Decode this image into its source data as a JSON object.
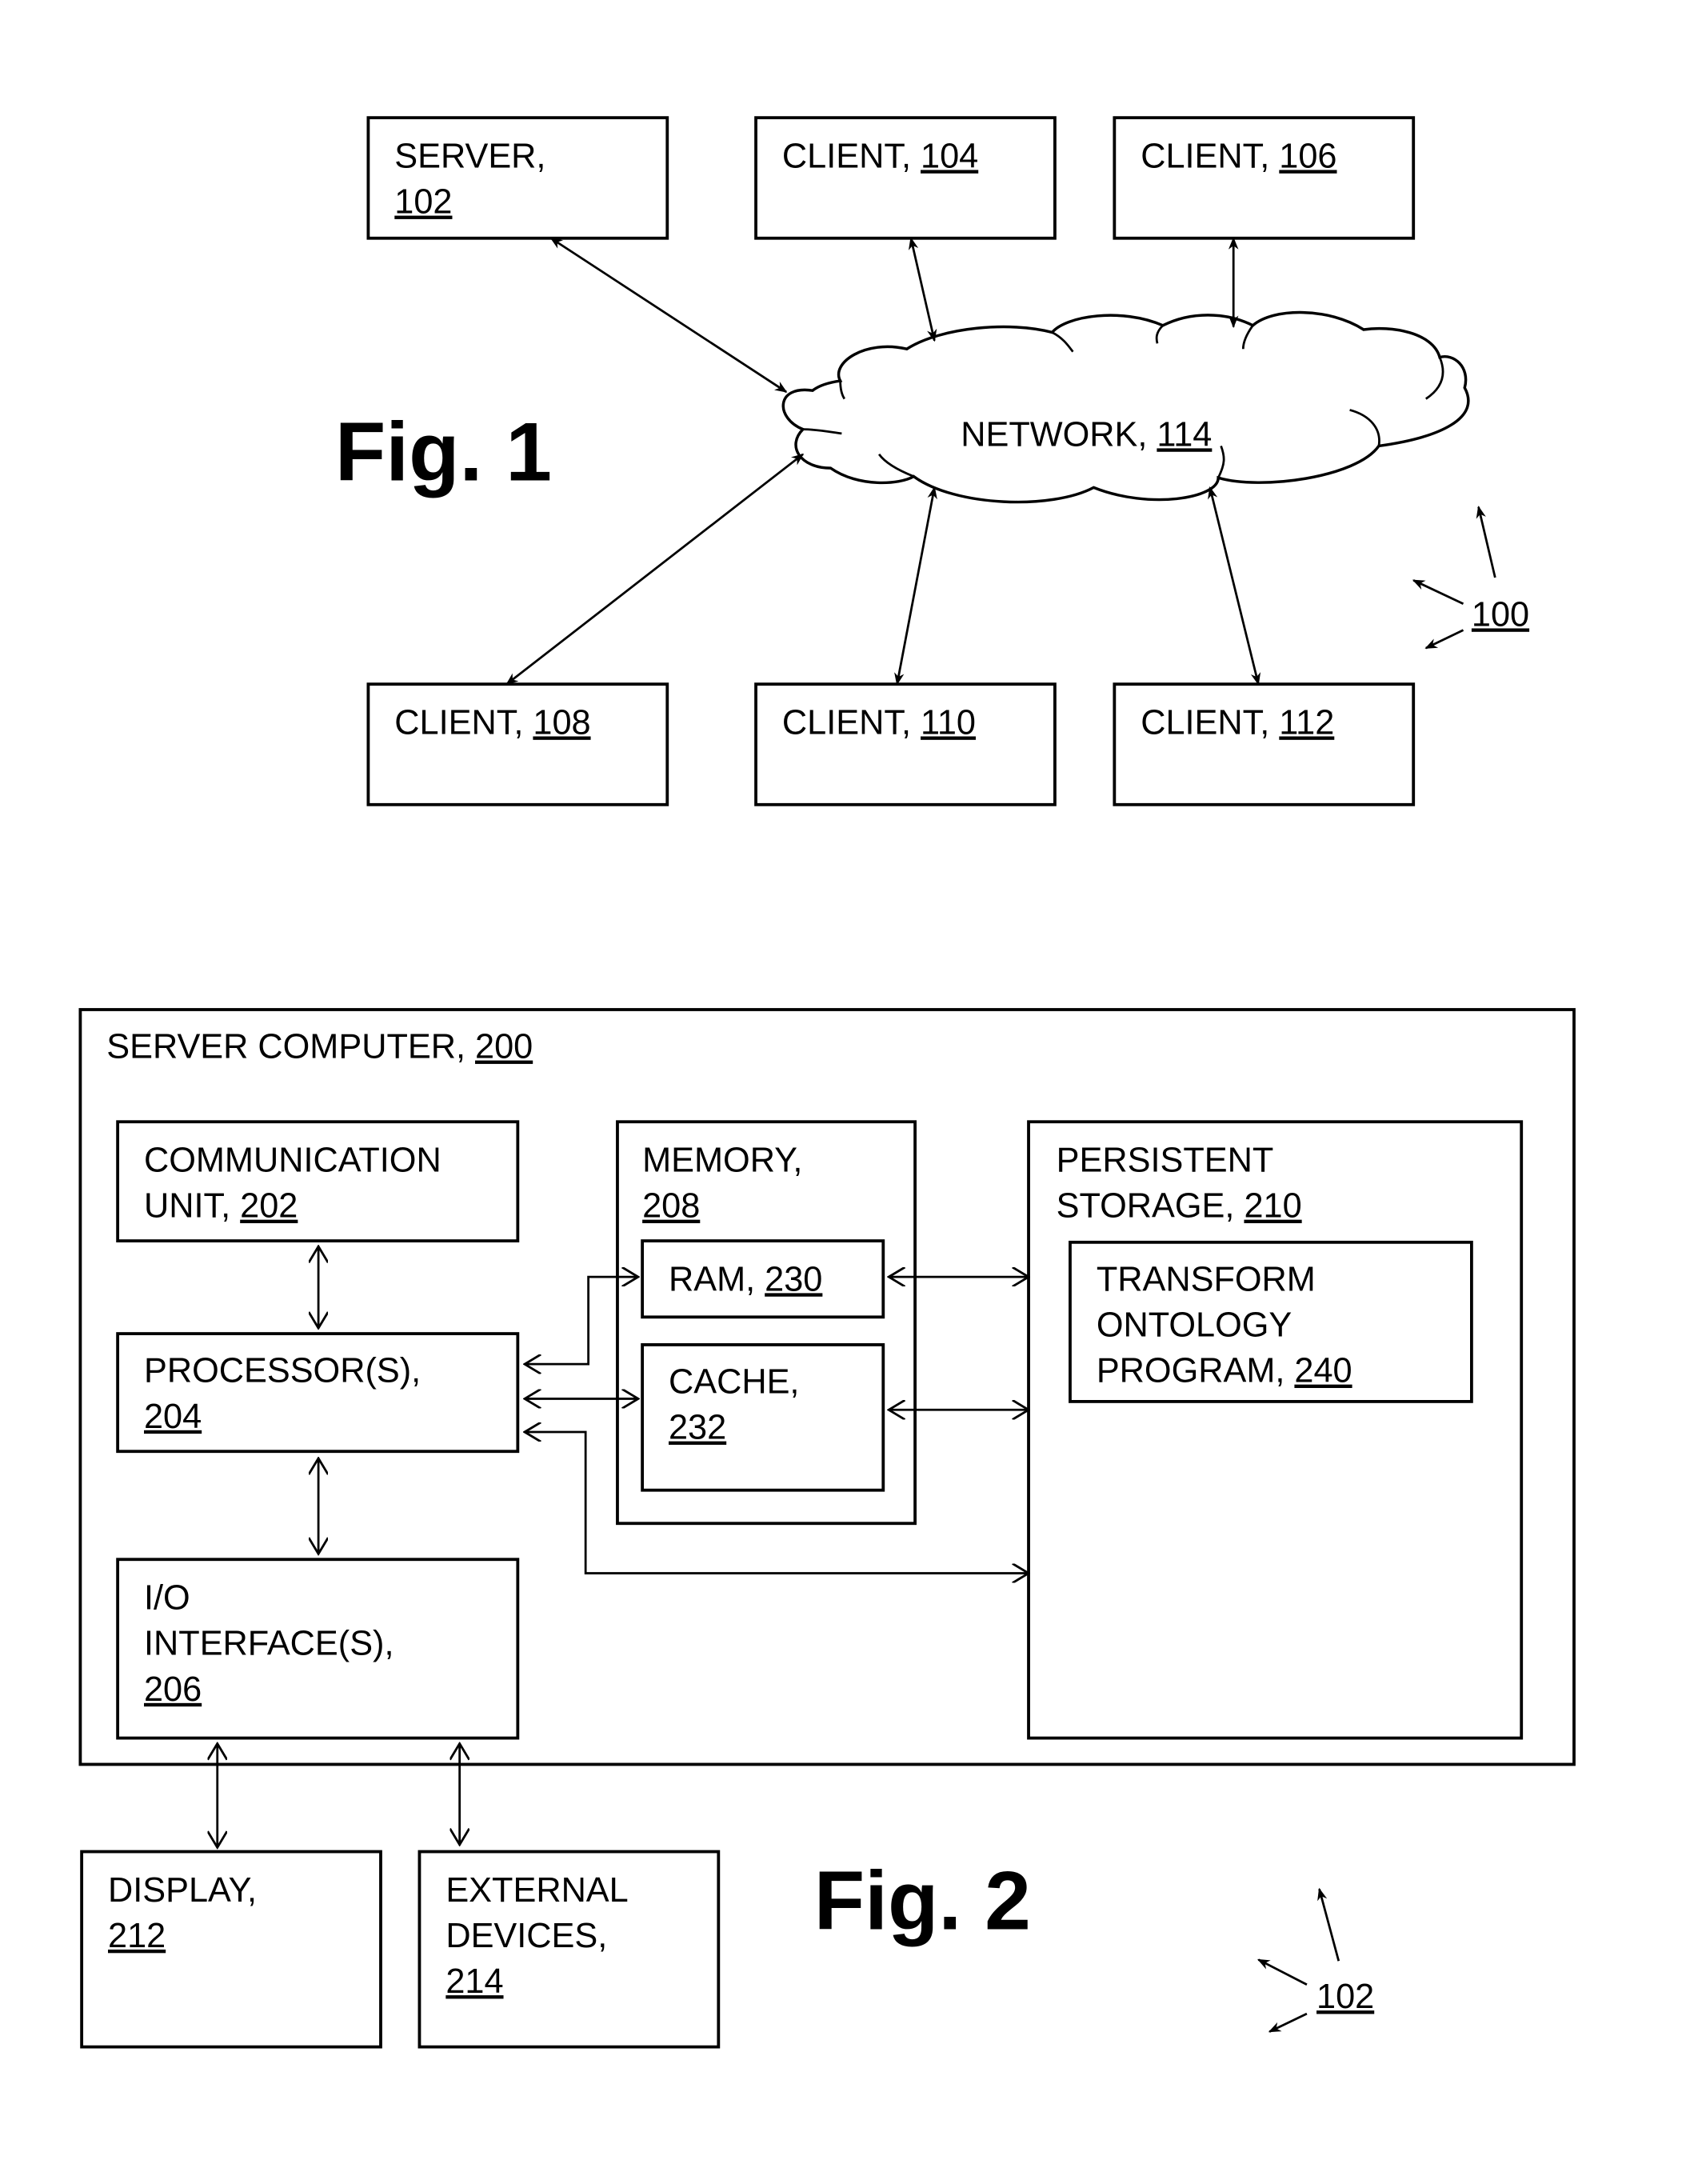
{
  "fig1": {
    "caption": "Fig. 1",
    "reference": "100",
    "server": {
      "label": "SERVER,",
      "ref": "102"
    },
    "network": {
      "label": "NETWORK, ",
      "ref": "114"
    },
    "clients": [
      {
        "label": "CLIENT, ",
        "ref": "104"
      },
      {
        "label": "CLIENT, ",
        "ref": "106"
      },
      {
        "label": "CLIENT, ",
        "ref": "108"
      },
      {
        "label": "CLIENT, ",
        "ref": "110"
      },
      {
        "label": "CLIENT, ",
        "ref": "112"
      }
    ]
  },
  "fig2": {
    "caption": "Fig. 2",
    "reference": "102",
    "server_computer": {
      "label": "SERVER COMPUTER, ",
      "ref": "200"
    },
    "communication_unit": {
      "line1": "COMMUNICATION",
      "line2": "UNIT, ",
      "ref": "202"
    },
    "processors": {
      "line1": "PROCESSOR(S),",
      "ref": "204"
    },
    "io_interfaces": {
      "line1": "I/O",
      "line2": "INTERFACE(S),",
      "ref": "206"
    },
    "memory": {
      "line1": "MEMORY,",
      "ref": "208"
    },
    "ram": {
      "label": "RAM, ",
      "ref": "230"
    },
    "cache": {
      "line1": "CACHE,",
      "ref": "232"
    },
    "persistent_storage": {
      "line1": "PERSISTENT",
      "line2": "STORAGE, ",
      "ref": "210"
    },
    "program": {
      "line1": "TRANSFORM",
      "line2": "ONTOLOGY",
      "line3": "PROGRAM, ",
      "ref": "240"
    },
    "display": {
      "line1": "DISPLAY,",
      "ref": "212"
    },
    "external_devices": {
      "line1": "EXTERNAL",
      "line2": "DEVICES,",
      "ref": "214"
    }
  }
}
